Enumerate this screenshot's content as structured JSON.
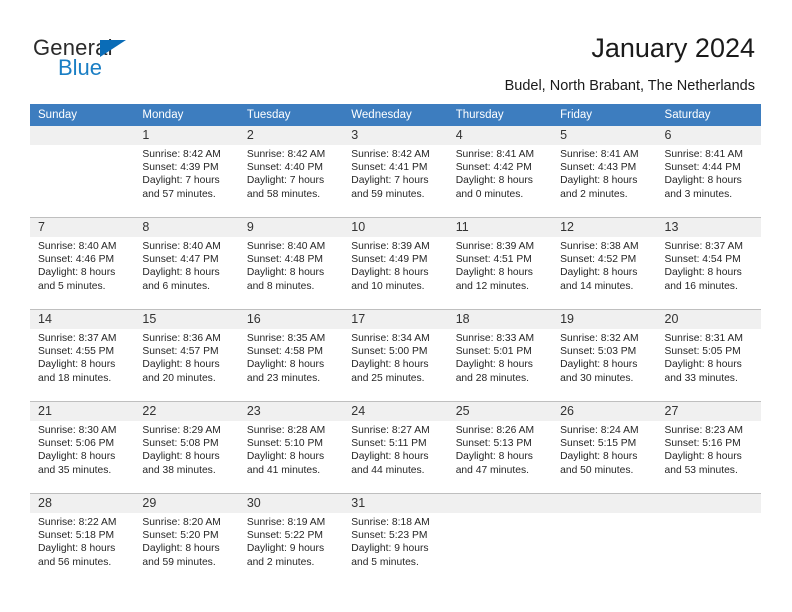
{
  "brand": {
    "name_part1": "General",
    "name_part2": "Blue"
  },
  "header": {
    "title": "January 2024",
    "subtitle": "Budel, North Brabant, The Netherlands"
  },
  "weekday_headers": [
    "Sunday",
    "Monday",
    "Tuesday",
    "Wednesday",
    "Thursday",
    "Friday",
    "Saturday"
  ],
  "colors": {
    "header_blue": "#3d7dbf",
    "daynum_band": "#f0f0f0",
    "brand_blue": "#1a7ec4",
    "text": "#262626"
  },
  "weeks": [
    [
      {
        "day": "",
        "blank": true
      },
      {
        "day": "1",
        "sunrise": "Sunrise: 8:42 AM",
        "sunset": "Sunset: 4:39 PM",
        "daylight1": "Daylight: 7 hours",
        "daylight2": "and 57 minutes."
      },
      {
        "day": "2",
        "sunrise": "Sunrise: 8:42 AM",
        "sunset": "Sunset: 4:40 PM",
        "daylight1": "Daylight: 7 hours",
        "daylight2": "and 58 minutes."
      },
      {
        "day": "3",
        "sunrise": "Sunrise: 8:42 AM",
        "sunset": "Sunset: 4:41 PM",
        "daylight1": "Daylight: 7 hours",
        "daylight2": "and 59 minutes."
      },
      {
        "day": "4",
        "sunrise": "Sunrise: 8:41 AM",
        "sunset": "Sunset: 4:42 PM",
        "daylight1": "Daylight: 8 hours",
        "daylight2": "and 0 minutes."
      },
      {
        "day": "5",
        "sunrise": "Sunrise: 8:41 AM",
        "sunset": "Sunset: 4:43 PM",
        "daylight1": "Daylight: 8 hours",
        "daylight2": "and 2 minutes."
      },
      {
        "day": "6",
        "sunrise": "Sunrise: 8:41 AM",
        "sunset": "Sunset: 4:44 PM",
        "daylight1": "Daylight: 8 hours",
        "daylight2": "and 3 minutes."
      }
    ],
    [
      {
        "day": "7",
        "sunrise": "Sunrise: 8:40 AM",
        "sunset": "Sunset: 4:46 PM",
        "daylight1": "Daylight: 8 hours",
        "daylight2": "and 5 minutes."
      },
      {
        "day": "8",
        "sunrise": "Sunrise: 8:40 AM",
        "sunset": "Sunset: 4:47 PM",
        "daylight1": "Daylight: 8 hours",
        "daylight2": "and 6 minutes."
      },
      {
        "day": "9",
        "sunrise": "Sunrise: 8:40 AM",
        "sunset": "Sunset: 4:48 PM",
        "daylight1": "Daylight: 8 hours",
        "daylight2": "and 8 minutes."
      },
      {
        "day": "10",
        "sunrise": "Sunrise: 8:39 AM",
        "sunset": "Sunset: 4:49 PM",
        "daylight1": "Daylight: 8 hours",
        "daylight2": "and 10 minutes."
      },
      {
        "day": "11",
        "sunrise": "Sunrise: 8:39 AM",
        "sunset": "Sunset: 4:51 PM",
        "daylight1": "Daylight: 8 hours",
        "daylight2": "and 12 minutes."
      },
      {
        "day": "12",
        "sunrise": "Sunrise: 8:38 AM",
        "sunset": "Sunset: 4:52 PM",
        "daylight1": "Daylight: 8 hours",
        "daylight2": "and 14 minutes."
      },
      {
        "day": "13",
        "sunrise": "Sunrise: 8:37 AM",
        "sunset": "Sunset: 4:54 PM",
        "daylight1": "Daylight: 8 hours",
        "daylight2": "and 16 minutes."
      }
    ],
    [
      {
        "day": "14",
        "sunrise": "Sunrise: 8:37 AM",
        "sunset": "Sunset: 4:55 PM",
        "daylight1": "Daylight: 8 hours",
        "daylight2": "and 18 minutes."
      },
      {
        "day": "15",
        "sunrise": "Sunrise: 8:36 AM",
        "sunset": "Sunset: 4:57 PM",
        "daylight1": "Daylight: 8 hours",
        "daylight2": "and 20 minutes."
      },
      {
        "day": "16",
        "sunrise": "Sunrise: 8:35 AM",
        "sunset": "Sunset: 4:58 PM",
        "daylight1": "Daylight: 8 hours",
        "daylight2": "and 23 minutes."
      },
      {
        "day": "17",
        "sunrise": "Sunrise: 8:34 AM",
        "sunset": "Sunset: 5:00 PM",
        "daylight1": "Daylight: 8 hours",
        "daylight2": "and 25 minutes."
      },
      {
        "day": "18",
        "sunrise": "Sunrise: 8:33 AM",
        "sunset": "Sunset: 5:01 PM",
        "daylight1": "Daylight: 8 hours",
        "daylight2": "and 28 minutes."
      },
      {
        "day": "19",
        "sunrise": "Sunrise: 8:32 AM",
        "sunset": "Sunset: 5:03 PM",
        "daylight1": "Daylight: 8 hours",
        "daylight2": "and 30 minutes."
      },
      {
        "day": "20",
        "sunrise": "Sunrise: 8:31 AM",
        "sunset": "Sunset: 5:05 PM",
        "daylight1": "Daylight: 8 hours",
        "daylight2": "and 33 minutes."
      }
    ],
    [
      {
        "day": "21",
        "sunrise": "Sunrise: 8:30 AM",
        "sunset": "Sunset: 5:06 PM",
        "daylight1": "Daylight: 8 hours",
        "daylight2": "and 35 minutes."
      },
      {
        "day": "22",
        "sunrise": "Sunrise: 8:29 AM",
        "sunset": "Sunset: 5:08 PM",
        "daylight1": "Daylight: 8 hours",
        "daylight2": "and 38 minutes."
      },
      {
        "day": "23",
        "sunrise": "Sunrise: 8:28 AM",
        "sunset": "Sunset: 5:10 PM",
        "daylight1": "Daylight: 8 hours",
        "daylight2": "and 41 minutes."
      },
      {
        "day": "24",
        "sunrise": "Sunrise: 8:27 AM",
        "sunset": "Sunset: 5:11 PM",
        "daylight1": "Daylight: 8 hours",
        "daylight2": "and 44 minutes."
      },
      {
        "day": "25",
        "sunrise": "Sunrise: 8:26 AM",
        "sunset": "Sunset: 5:13 PM",
        "daylight1": "Daylight: 8 hours",
        "daylight2": "and 47 minutes."
      },
      {
        "day": "26",
        "sunrise": "Sunrise: 8:24 AM",
        "sunset": "Sunset: 5:15 PM",
        "daylight1": "Daylight: 8 hours",
        "daylight2": "and 50 minutes."
      },
      {
        "day": "27",
        "sunrise": "Sunrise: 8:23 AM",
        "sunset": "Sunset: 5:16 PM",
        "daylight1": "Daylight: 8 hours",
        "daylight2": "and 53 minutes."
      }
    ],
    [
      {
        "day": "28",
        "sunrise": "Sunrise: 8:22 AM",
        "sunset": "Sunset: 5:18 PM",
        "daylight1": "Daylight: 8 hours",
        "daylight2": "and 56 minutes."
      },
      {
        "day": "29",
        "sunrise": "Sunrise: 8:20 AM",
        "sunset": "Sunset: 5:20 PM",
        "daylight1": "Daylight: 8 hours",
        "daylight2": "and 59 minutes."
      },
      {
        "day": "30",
        "sunrise": "Sunrise: 8:19 AM",
        "sunset": "Sunset: 5:22 PM",
        "daylight1": "Daylight: 9 hours",
        "daylight2": "and 2 minutes."
      },
      {
        "day": "31",
        "sunrise": "Sunrise: 8:18 AM",
        "sunset": "Sunset: 5:23 PM",
        "daylight1": "Daylight: 9 hours",
        "daylight2": "and 5 minutes."
      },
      {
        "day": "",
        "blank": true
      },
      {
        "day": "",
        "blank": true
      },
      {
        "day": "",
        "blank": true
      }
    ]
  ]
}
